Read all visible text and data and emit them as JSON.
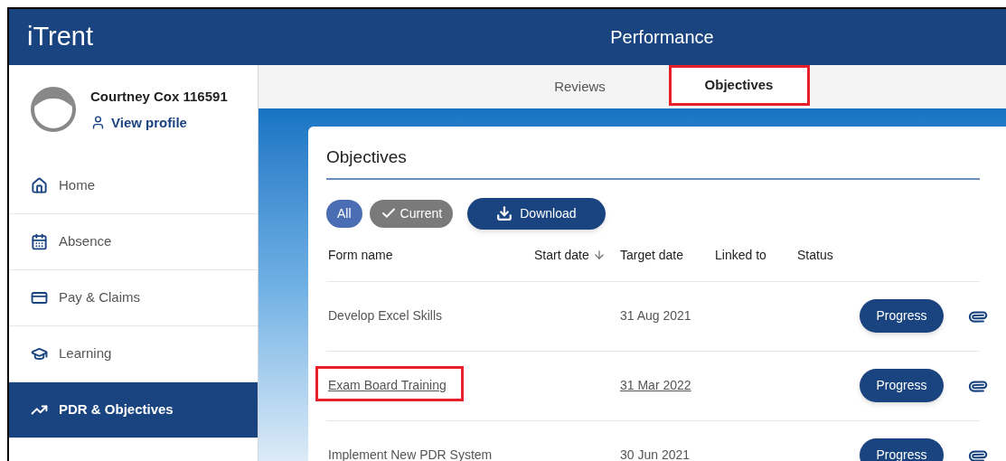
{
  "header": {
    "logo": "iTrent",
    "title": "Performance"
  },
  "profile": {
    "name": "Courtney Cox 116591",
    "link": "View profile"
  },
  "sidebar": {
    "items": [
      {
        "label": "Home",
        "selected": false
      },
      {
        "label": "Absence",
        "selected": false
      },
      {
        "label": "Pay & Claims",
        "selected": false
      },
      {
        "label": "Learning",
        "selected": false
      },
      {
        "label": "PDR & Objectives",
        "selected": true
      }
    ]
  },
  "tabs": [
    {
      "label": "Reviews",
      "selected": false,
      "highlighted": false
    },
    {
      "label": "Objectives",
      "selected": true,
      "highlighted": true
    }
  ],
  "card": {
    "title": "Objectives",
    "filters": [
      {
        "label": "All",
        "selected": true,
        "checked": false
      },
      {
        "label": "Current",
        "selected": false,
        "checked": true
      }
    ],
    "download": "Download",
    "columns": [
      {
        "label": "Form name",
        "sorted": false
      },
      {
        "label": "Start date",
        "sorted": true
      },
      {
        "label": "Target date",
        "sorted": false
      },
      {
        "label": "Linked to",
        "sorted": false
      },
      {
        "label": "Status",
        "sorted": false
      }
    ],
    "rows": [
      {
        "form_name": "Develop Excel Skills",
        "target_date": "31 Aug 2021",
        "link": false,
        "highlighted": false,
        "action": "Progress"
      },
      {
        "form_name": "Exam Board Training",
        "target_date": "31 Mar 2022",
        "link": true,
        "highlighted": true,
        "action": "Progress"
      },
      {
        "form_name": "Implement New PDR System",
        "target_date": "30 Jun 2021",
        "link": false,
        "highlighted": false,
        "action": "Progress"
      }
    ]
  }
}
